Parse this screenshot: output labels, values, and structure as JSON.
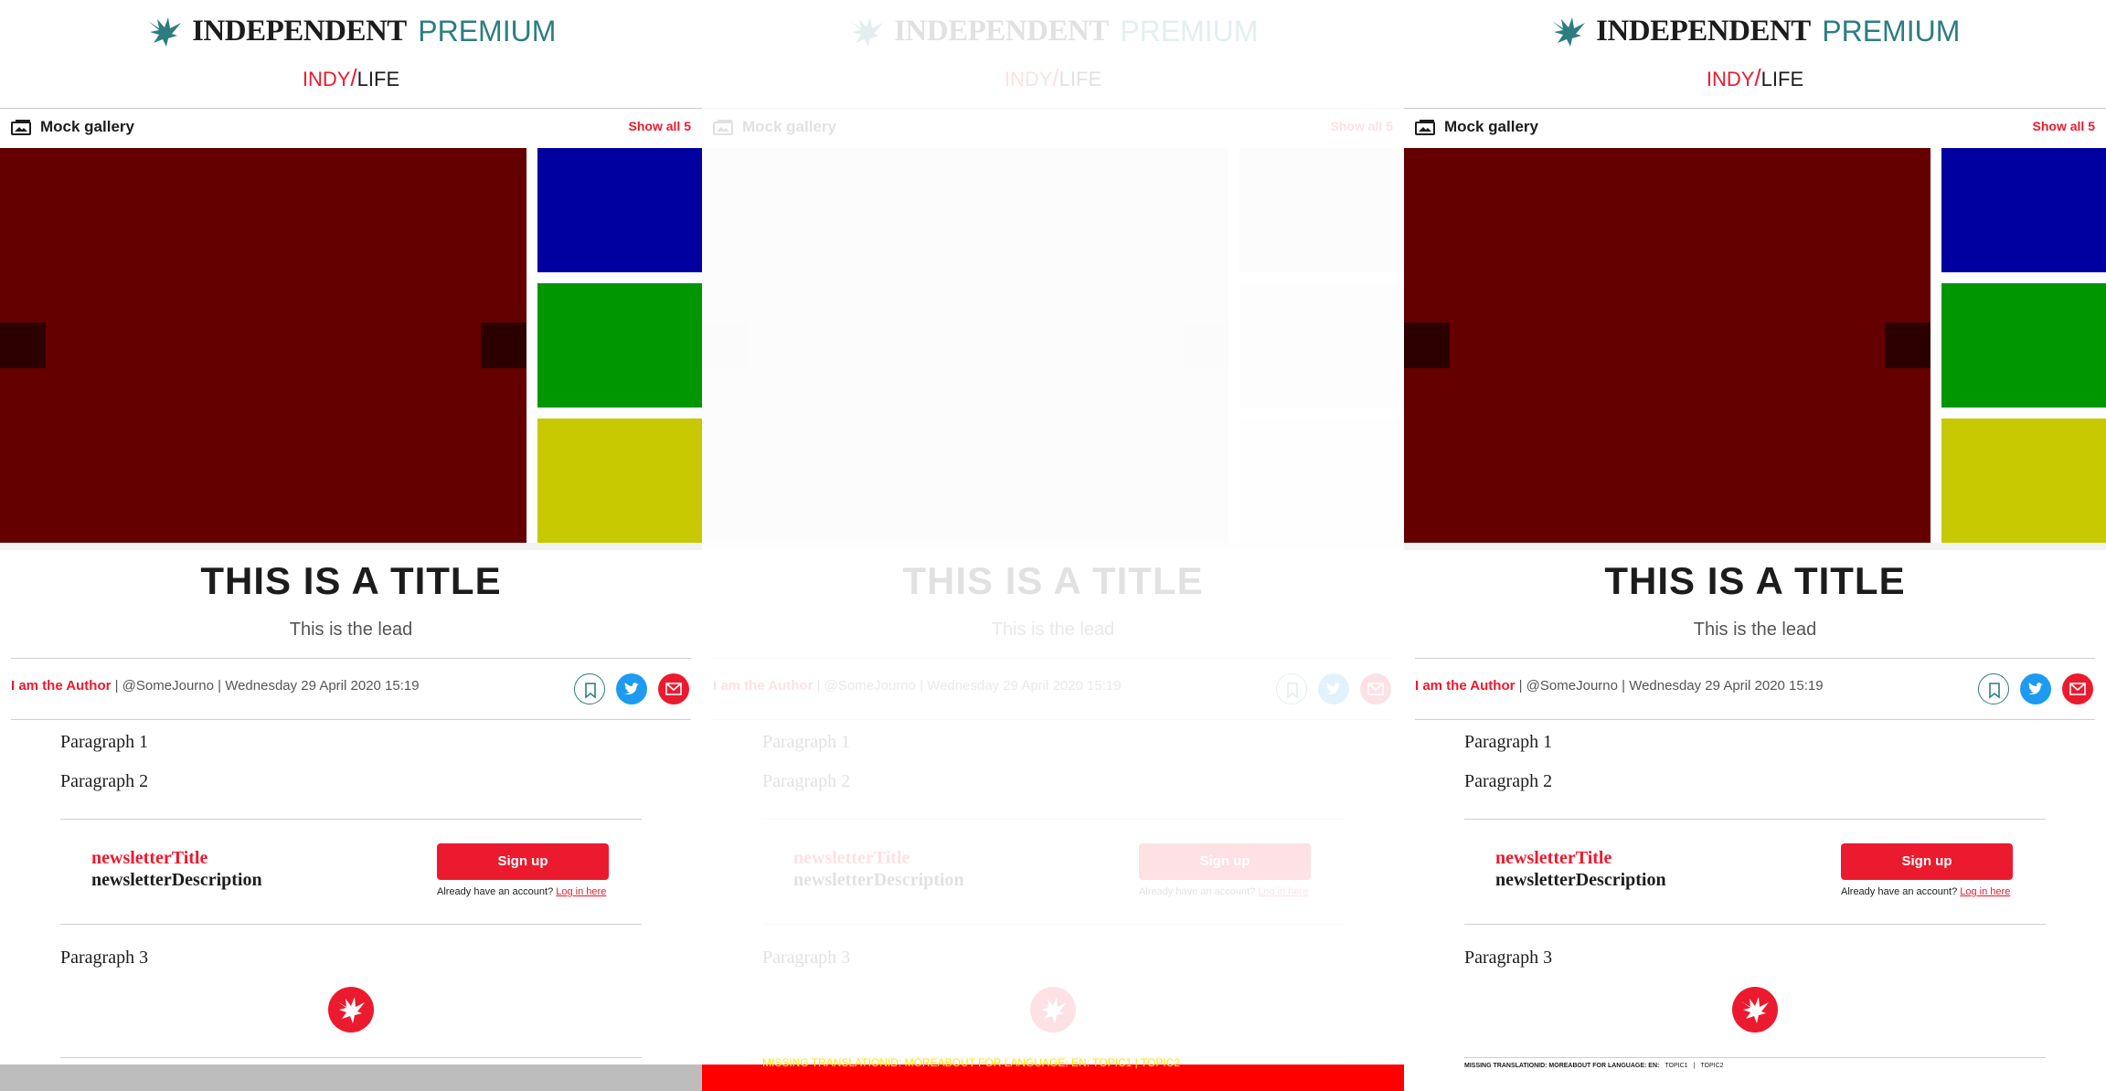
{
  "brand": {
    "name": "INDEPENDENT",
    "premium": "PREMIUM",
    "section_indy": "INDY",
    "section_slash": "/",
    "section_life": "LIFE"
  },
  "gallery": {
    "title": "Mock gallery",
    "show_all": "Show all 5",
    "main_color": "#640000",
    "thumb_colors": [
      "#0000a0",
      "#009600",
      "#c8c800"
    ],
    "faded_main_color": "#e6e6e6",
    "faded_thumb_colors": [
      "#e6e6e6",
      "#ececec",
      "#f4f4f4"
    ]
  },
  "article": {
    "title": "THIS IS A TITLE",
    "lead": "This is the lead",
    "author": "I am the Author",
    "handle": " | @SomeJourno | ",
    "date": "Wednesday 29 April 2020 15:19",
    "paragraphs": [
      "Paragraph 1",
      "Paragraph 2",
      "Paragraph 3"
    ]
  },
  "newsletter": {
    "title": "newsletterTitle",
    "description": "newsletterDescription",
    "signup": "Sign up",
    "account_text": "Already have an account? ",
    "login": "Log in here"
  },
  "footer": {
    "missing_translation": "MISSING TRANSLATIONID: MOREABOUT FOR LANGUAGE: EN:",
    "topic1": "TOPIC1",
    "topic2": "TOPIC2",
    "overflow_text": "MISSING TRANSLATIONID: MOREABOUT FOR LANGUAGE: EN: TOPIC1 | TOPIC2"
  },
  "icons": {
    "gallery": "gallery-icon",
    "bookmark": "bookmark-icon",
    "twitter": "twitter-icon",
    "email": "email-icon",
    "eagle": "eagle-logo-icon"
  },
  "colors": {
    "accent_red": "#ec1a2e",
    "premium_teal": "#2d7d80",
    "twitter_blue": "#1d9bf0",
    "footer_grey": "#bdbdbd",
    "footer_red": "#fe0000"
  }
}
